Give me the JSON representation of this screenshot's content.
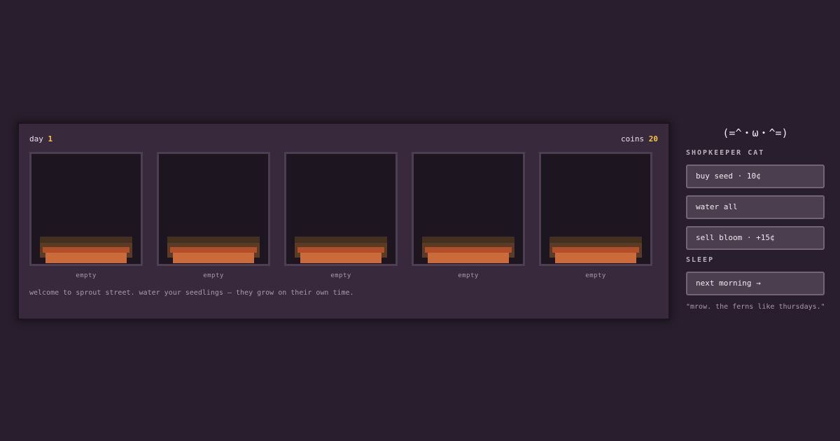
{
  "hud": {
    "day_label": "day",
    "day_value": "1",
    "coins_label": "coins",
    "coins_value": "20"
  },
  "plots": [
    {
      "status": "empty"
    },
    {
      "status": "empty"
    },
    {
      "status": "empty"
    },
    {
      "status": "empty"
    },
    {
      "status": "empty"
    }
  ],
  "message": "welcome to sprout street. water your seedlings — they grow on their own time.",
  "shop": {
    "cat_face": "(=^・ω・^=)",
    "title": "SHOPKEEPER CAT",
    "buy_seed": "buy seed · 10¢",
    "water_all": "water all",
    "sell_bloom": "sell bloom · +15¢"
  },
  "sleep": {
    "title": "SLEEP",
    "next_morning": "next morning →"
  },
  "quote": "\"mrow. the ferns like thursdays.\"",
  "colors": {
    "background": "#281e2d",
    "panel": "#39293d",
    "highlight": "#f5c842",
    "pot": "#cb6b3c"
  }
}
